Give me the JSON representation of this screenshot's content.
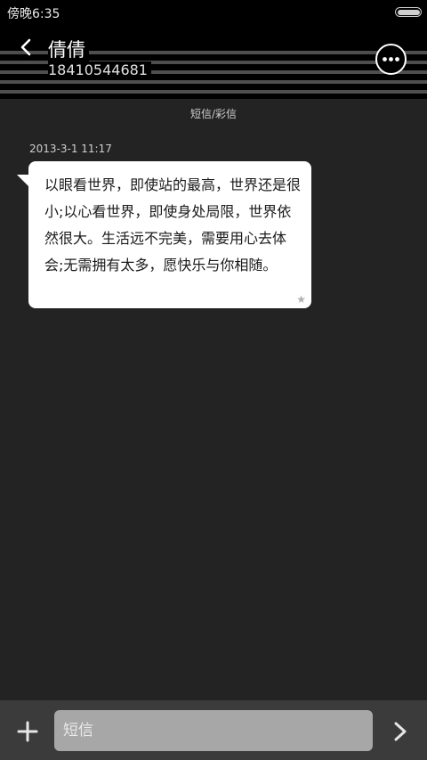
{
  "status_bar": {
    "time": "傍晚6:35",
    "battery_level": 1.0
  },
  "header": {
    "contact_name": "倩倩",
    "phone_number": "18410544681",
    "back_icon": "chevron-left-icon",
    "more_icon": "more-horizontal-icon"
  },
  "thread": {
    "label": "短信/彩信",
    "messages": [
      {
        "time": "2013-3-1 11:17",
        "text": "以眼看世界，即使站的最高，世界还是很小;以心看世界，即使身处局限，世界依然很大。生活远不完美，需要用心去体会;无需拥有太多，愿快乐与你相随。",
        "star": "★"
      }
    ]
  },
  "composer": {
    "placeholder": "短信",
    "add_icon": "plus-icon",
    "send_icon": "chevron-right-icon"
  },
  "colors": {
    "background": "#232323",
    "header": "#000000",
    "bubble": "#ffffff",
    "input": "#a7a7a7",
    "bottom_bar": "#3b3b3b"
  }
}
